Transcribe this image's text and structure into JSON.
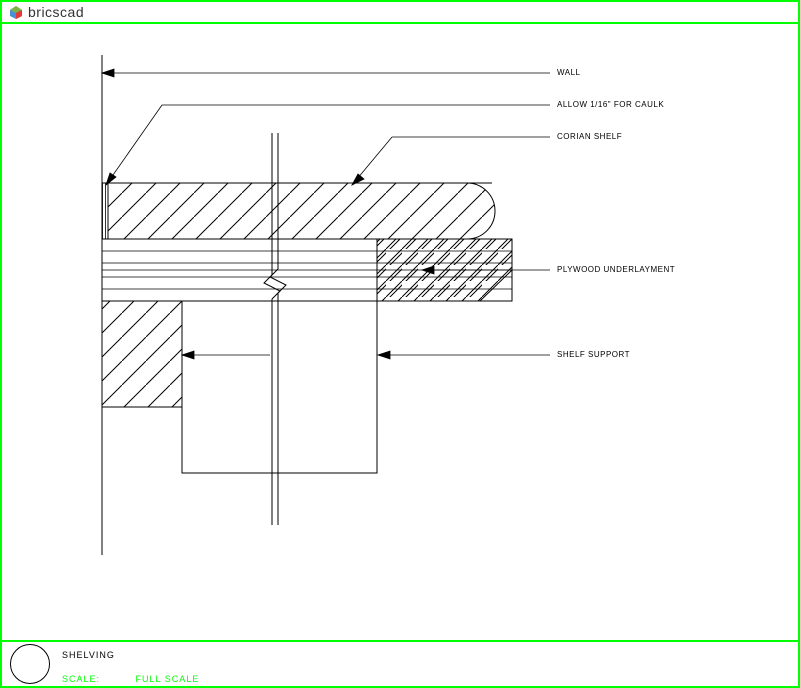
{
  "app": {
    "name": "bricscad"
  },
  "drawing": {
    "title": "SHELVING",
    "scale_label": "SCALE:",
    "scale_value": "FULL SCALE"
  },
  "labels": {
    "wall": "WALL",
    "caulk": "ALLOW 1/16\" FOR CAULK",
    "shelf": "CORIAN SHELF",
    "underlayment": "PLYWOOD UNDERLAYMENT",
    "support": "SHELF SUPPORT"
  }
}
